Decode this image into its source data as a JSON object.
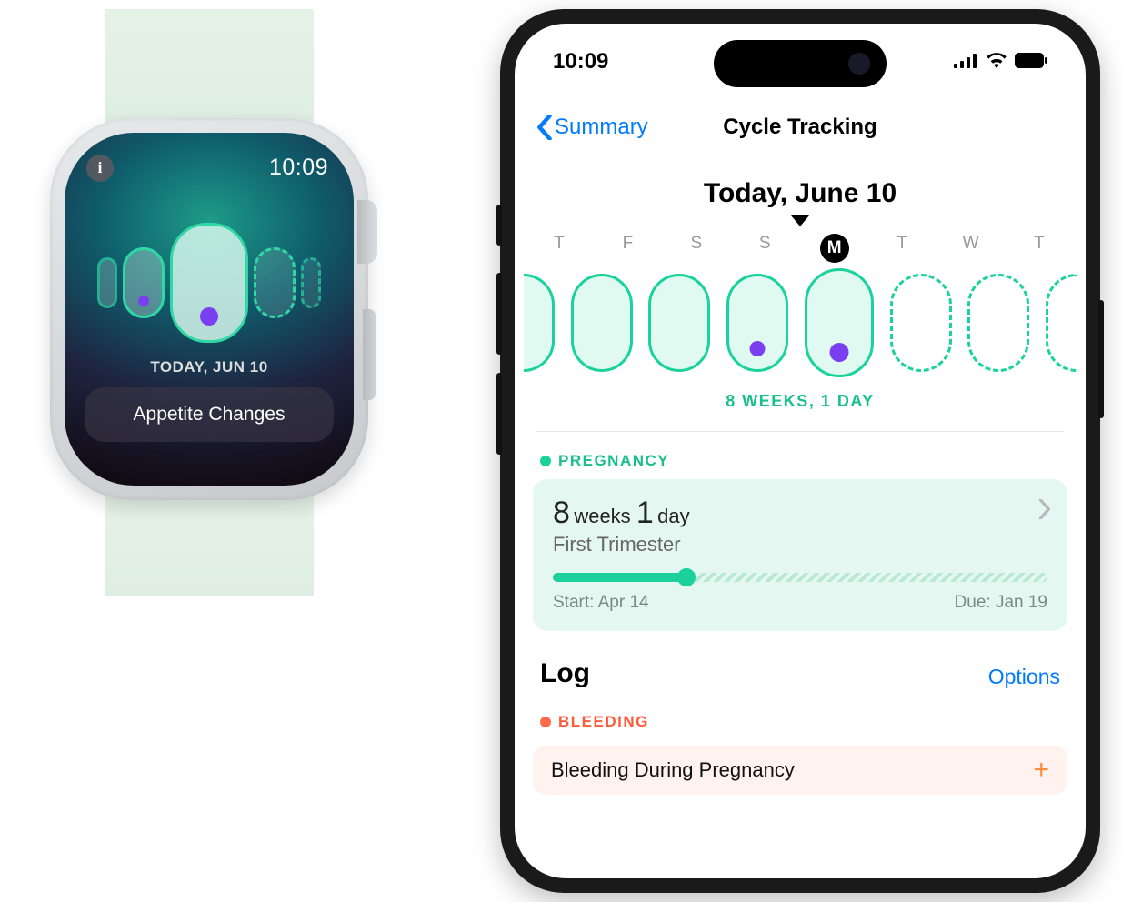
{
  "watch": {
    "time": "10:09",
    "today_label": "TODAY, JUN 10",
    "symptom_chip": "Appetite Changes",
    "pills": [
      {
        "size": "xs",
        "dot": false,
        "dashed": false
      },
      {
        "size": "s",
        "dot": true,
        "dashed": false
      },
      {
        "size": "l",
        "dot": true,
        "dashed": false
      },
      {
        "size": "s",
        "dot": false,
        "dashed": true
      },
      {
        "size": "xs",
        "dot": false,
        "dashed": true
      }
    ]
  },
  "phone": {
    "status": {
      "time": "10:09"
    },
    "nav": {
      "back_label": "Summary",
      "title": "Cycle Tracking"
    },
    "date_heading": "Today, June 10",
    "weekdays": [
      "T",
      "F",
      "S",
      "S",
      "M",
      "T",
      "W",
      "T"
    ],
    "today_index": 4,
    "cycle_pills": [
      {
        "cut_left": true,
        "future": false,
        "dot": false
      },
      {
        "future": false,
        "dot": false
      },
      {
        "future": false,
        "dot": false
      },
      {
        "future": false,
        "dot": true
      },
      {
        "future": false,
        "dot": true,
        "today": true
      },
      {
        "future": true,
        "dot": false
      },
      {
        "future": true,
        "dot": false
      },
      {
        "cut_right": true,
        "future": true,
        "dot": false
      }
    ],
    "gestation_strip": "8 WEEKS, 1 DAY",
    "pregnancy": {
      "section_label": "PREGNANCY",
      "weeks_num": "8",
      "weeks_word": "weeks",
      "days_num": "1",
      "days_word": "day",
      "trimester": "First Trimester",
      "progress_pct": 27,
      "start_label": "Start: Apr 14",
      "due_label": "Due: Jan 19"
    },
    "log": {
      "heading": "Log",
      "options_label": "Options",
      "bleeding_label": "BLEEDING",
      "row_label": "Bleeding During Pregnancy"
    }
  }
}
